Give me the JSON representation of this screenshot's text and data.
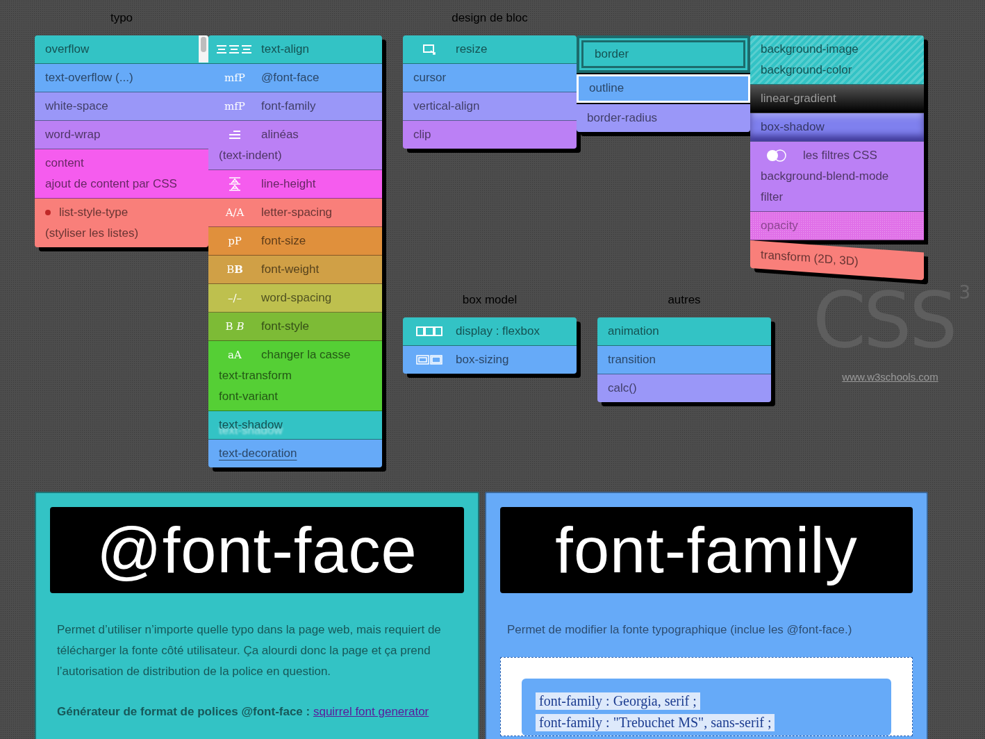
{
  "groups": [
    {
      "title": "typo",
      "columns": [
        {
          "items": [
            {
              "kind": "scroll",
              "label": "overflow",
              "color": "#33c3c5"
            },
            {
              "kind": "plain",
              "label": "text-overflow (...)",
              "color": "#66aaf8"
            },
            {
              "kind": "plain",
              "label": "white-space",
              "color": "#9a97f8"
            },
            {
              "kind": "plain",
              "label": "word-wrap",
              "color": "#bb80f5"
            },
            {
              "kind": "plain",
              "label": "content",
              "extra": [
                "ajout de content par CSS"
              ],
              "color": "#f55cee"
            },
            {
              "kind": "bullet",
              "label": "list-style-type",
              "extra": [
                "(styliser les listes)"
              ],
              "color": "#f97f7a"
            }
          ]
        },
        {
          "items": [
            {
              "kind": "icon",
              "label": "text-align",
              "color": "#33c3c5"
            },
            {
              "kind": "glyph",
              "glyph": "mfP",
              "label": "@font-face",
              "color": "#66aaf8"
            },
            {
              "kind": "glyph",
              "glyph": "mfP",
              "label": "font-family",
              "color": "#9a97f8"
            },
            {
              "kind": "icon",
              "label": "alinéas",
              "extra": [
                "(text-indent)"
              ],
              "color": "#bb80f5"
            },
            {
              "kind": "icon",
              "label": "line-height",
              "color": "#f55cee"
            },
            {
              "kind": "glyph",
              "glyph": "A/A",
              "label": "letter-spacing",
              "color": "#f97f7a"
            },
            {
              "kind": "glyph",
              "glyph": "pP",
              "label": "font-size",
              "color": "#e0903c"
            },
            {
              "kind": "glyph",
              "glyph": "B**B**",
              "label": "font-weight",
              "color": "#d0a046"
            },
            {
              "kind": "glyph",
              "glyph": "–/–",
              "label": "word-spacing",
              "color": "#bec04e"
            },
            {
              "kind": "glyph",
              "glyph": "B *B*",
              "label": "font-style",
              "color": "#7dbb36"
            },
            {
              "kind": "glyph",
              "glyph": "aA",
              "label": "changer la casse",
              "extra": [
                "text-transform",
                "font-variant"
              ],
              "color": "#55cf35"
            },
            {
              "kind": "shadow-text",
              "label": "text-shadow",
              "color": "#33c3c5"
            },
            {
              "kind": "underline",
              "label": "text-decoration",
              "color": "#66aaf8"
            }
          ]
        }
      ]
    },
    {
      "title": "design de bloc",
      "columns": [
        {
          "items": [
            {
              "kind": "icon",
              "label": "resize",
              "color": "#33c3c5"
            },
            {
              "kind": "plain",
              "label": "cursor",
              "color": "#66aaf8"
            },
            {
              "kind": "plain",
              "label": "vertical-align",
              "color": "#9a97f8"
            },
            {
              "kind": "plain",
              "label": "clip",
              "color": "#bb80f5"
            }
          ]
        },
        {
          "items": [
            {
              "kind": "border",
              "label": "border",
              "color": "#33c3c5"
            },
            {
              "kind": "outline",
              "label": "outline",
              "color": "#66aaf8"
            },
            {
              "kind": "rounded",
              "label": "border-radius",
              "color": "#9a97f8"
            }
          ]
        },
        {
          "items": [
            {
              "kind": "striped",
              "label": "background-image",
              "extra": [
                "background-color"
              ],
              "color": "#33c3c5"
            },
            {
              "kind": "gradient",
              "label": "linear-gradient",
              "color": "#555555"
            },
            {
              "kind": "inset-shadow",
              "label": "box-shadow",
              "color": "#7f80ee"
            },
            {
              "kind": "icon",
              "label": "les filtres CSS",
              "extra": [
                "background-blend-mode",
                "filter"
              ],
              "color": "#bb80f5"
            },
            {
              "kind": "faded",
              "label": "opacity",
              "color": "#e070e8"
            },
            {
              "kind": "skewed",
              "label": "transform (2D, 3D)",
              "color": "#f97f7a"
            }
          ]
        }
      ]
    },
    {
      "title": "box model",
      "columns": [
        {
          "items": [
            {
              "kind": "icon",
              "label": "display : flexbox",
              "color": "#33c3c5"
            },
            {
              "kind": "icon",
              "label": "box-sizing",
              "color": "#66aaf8"
            }
          ]
        }
      ]
    },
    {
      "title": "autres",
      "columns": [
        {
          "items": [
            {
              "kind": "plain",
              "label": "animation",
              "color": "#33c3c5"
            },
            {
              "kind": "plain",
              "label": "transition",
              "color": "#66aaf8"
            },
            {
              "kind": "plain",
              "label": "calc()",
              "color": "#9a97f8"
            }
          ]
        }
      ]
    }
  ],
  "logo": {
    "text": "CSS",
    "sup": "3",
    "link": "www.w3schools.com"
  },
  "cards": [
    {
      "title": "@font-face",
      "color": "#33c3c5",
      "paragraphs": [
        "Permet d’utiliser n’importe quelle typo dans la page web, mais requiert de télécharger la fonte côté utilisateur. Ça alourdi donc la page et ça prend l’autorisation de distribution de la police en question."
      ],
      "note": "Générateur de format de polices @font-face : ",
      "link": "squirrel font generator"
    },
    {
      "title": "font-family",
      "color": "#66aaf8",
      "paragraphs": [
        "Permet de modifier la fonte typographique (inclue les @font-face.)"
      ],
      "code": [
        "font-family : Georgia, serif ;",
        "font-family : \"Trebuchet MS\", sans-serif ;"
      ]
    }
  ]
}
